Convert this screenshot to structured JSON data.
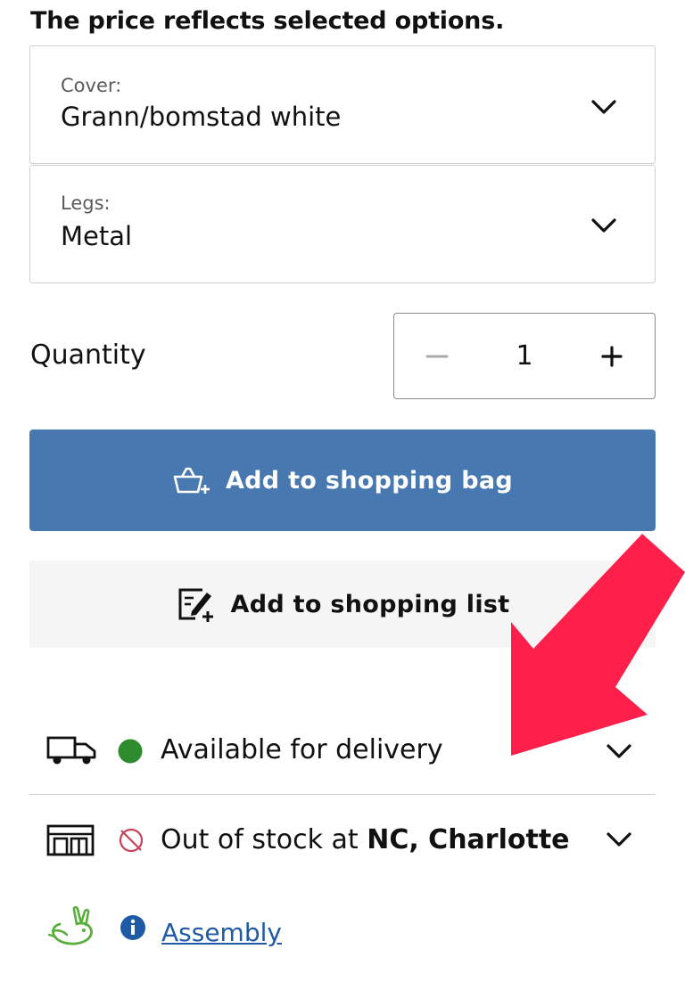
{
  "price_note": "The price reflects selected options.",
  "options": {
    "cover": {
      "label": "Cover:",
      "value": "Grann/bomstad white"
    },
    "legs": {
      "label": "Legs:",
      "value": "Metal"
    }
  },
  "quantity": {
    "label": "Quantity",
    "value": "1"
  },
  "buttons": {
    "add_to_bag": "Add to shopping bag",
    "add_to_list": "Add to shopping list"
  },
  "availability": {
    "delivery": {
      "text": "Available for delivery",
      "status_color": "#2e8b2e"
    },
    "store": {
      "text_prefix": "Out of stock at ",
      "store_name": "NC, Charlotte",
      "status_color": "#c8415a"
    }
  },
  "assembly": {
    "link": "Assembly"
  },
  "colors": {
    "primary": "#4878b0",
    "annotation_arrow": "#ff1f4b"
  }
}
